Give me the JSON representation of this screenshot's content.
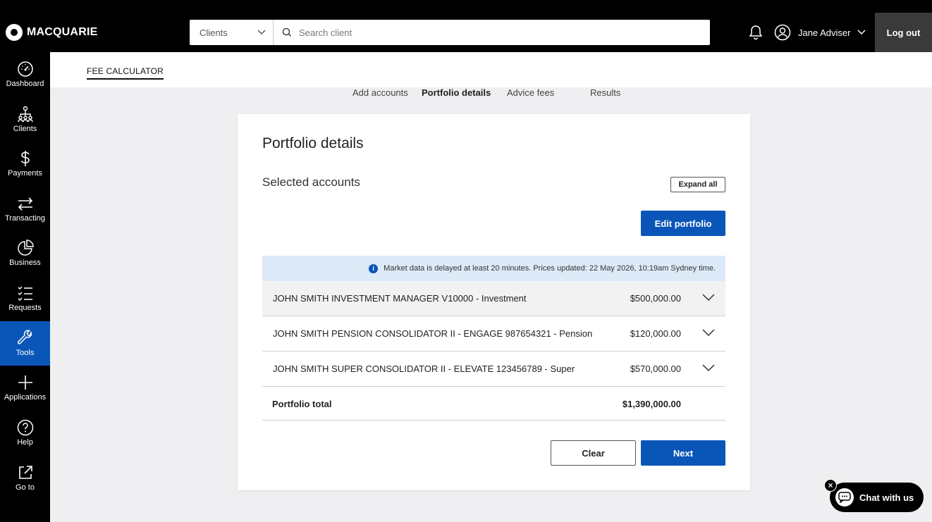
{
  "header": {
    "brand": "MACQUARIE",
    "search_scope": "Clients",
    "search_placeholder": "Search client",
    "user_name": "Jane Adviser",
    "logout_label": "Log out"
  },
  "sidebar": {
    "items": [
      {
        "label": "Dashboard",
        "icon": "dashboard-icon"
      },
      {
        "label": "Clients",
        "icon": "clients-icon"
      },
      {
        "label": "Payments",
        "icon": "dollar-icon"
      },
      {
        "label": "Transacting",
        "icon": "transfer-icon"
      },
      {
        "label": "Business",
        "icon": "pie-chart-icon"
      },
      {
        "label": "Requests",
        "icon": "list-icon"
      },
      {
        "label": "Tools",
        "icon": "wrench-icon",
        "active": true
      },
      {
        "label": "Applications",
        "icon": "plus-icon"
      },
      {
        "label": "Help",
        "icon": "help-icon"
      },
      {
        "label": "Go to",
        "icon": "external-link-icon"
      }
    ]
  },
  "page": {
    "label": "FEE CALCULATOR",
    "steps": [
      "Add accounts",
      "Portfolio details",
      "Advice fees",
      "Results"
    ],
    "active_step": "Portfolio details"
  },
  "card": {
    "title": "Portfolio details",
    "section_title": "Selected accounts",
    "expand_label": "Expand all",
    "edit_label": "Edit portfolio",
    "notice": "Market data is delayed at least 20 minutes. Prices updated: 22 May 2026, 10:19am Sydney time.",
    "accounts": [
      {
        "name": "JOHN SMITH INVESTMENT MANAGER V10000 - Investment",
        "amount": "$500,000.00"
      },
      {
        "name": "JOHN SMITH PENSION CONSOLIDATOR II - ENGAGE 987654321 - Pension",
        "amount": "$120,000.00"
      },
      {
        "name": "JOHN SMITH SUPER CONSOLIDATOR II - ELEVATE 123456789 - Super",
        "amount": "$570,000.00"
      }
    ],
    "total_label": "Portfolio total",
    "total_amount": "$1,390,000.00",
    "clear_label": "Clear",
    "next_label": "Next"
  },
  "chat": {
    "label": "Chat with us"
  },
  "colors": {
    "primary": "#0a56b8",
    "topbar": "#000000",
    "notice_bg": "#dceaf7"
  }
}
